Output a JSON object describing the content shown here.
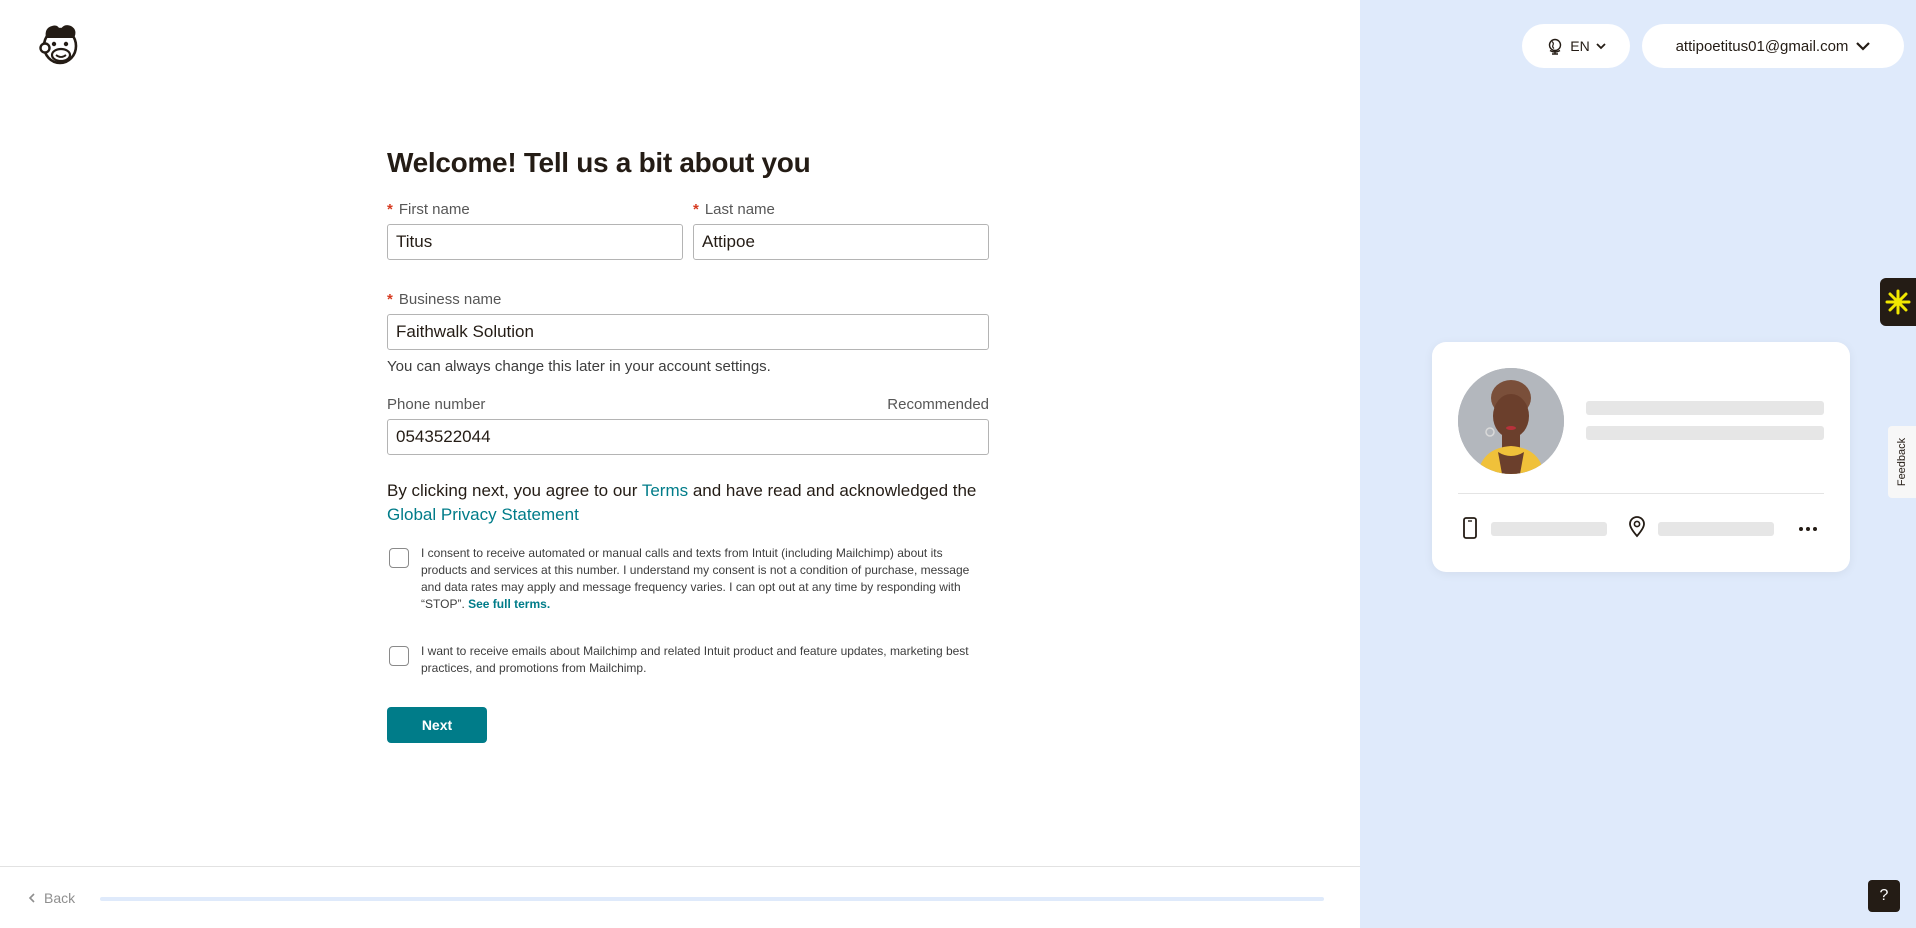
{
  "header": {
    "language": "EN",
    "account_email": "attipoetitus01@gmail.com"
  },
  "form": {
    "title": "Welcome! Tell us a bit about you",
    "required_mark": "*",
    "first_name": {
      "label": "First name",
      "value": "Titus"
    },
    "last_name": {
      "label": "Last name",
      "value": "Attipoe"
    },
    "business_name": {
      "label": "Business name",
      "value": "Faithwalk Solution",
      "hint": "You can always change this later in your account settings."
    },
    "phone": {
      "label": "Phone number",
      "badge": "Recommended",
      "value": "0543522044"
    },
    "agreement": {
      "prefix": "By clicking next, you agree to our ",
      "terms_link": "Terms",
      "middle": " and have read and acknowledged the ",
      "privacy_link": "Global Privacy Statement"
    },
    "consent_calls": {
      "text": "I consent to receive automated or manual calls and texts from Intuit (including Mailchimp) about its products and services at this number. I understand my consent is not a condition of purchase, message and data rates may apply and message frequency varies. I can opt out at any time by responding with “STOP”. ",
      "link": "See full terms.",
      "checked": false
    },
    "consent_emails": {
      "text": "I want to receive emails about Mailchimp and related Intuit product and feature updates, marketing best practices, and promotions from Mailchimp.",
      "checked": false
    },
    "next_label": "Next"
  },
  "footer": {
    "back_label": "Back",
    "progress_fraction": 0
  },
  "side": {
    "feedback_label": "Feedback",
    "help_label": "?"
  },
  "colors": {
    "accent": "#007c89",
    "required": "#d63a20",
    "panel": "#dfeafb"
  }
}
